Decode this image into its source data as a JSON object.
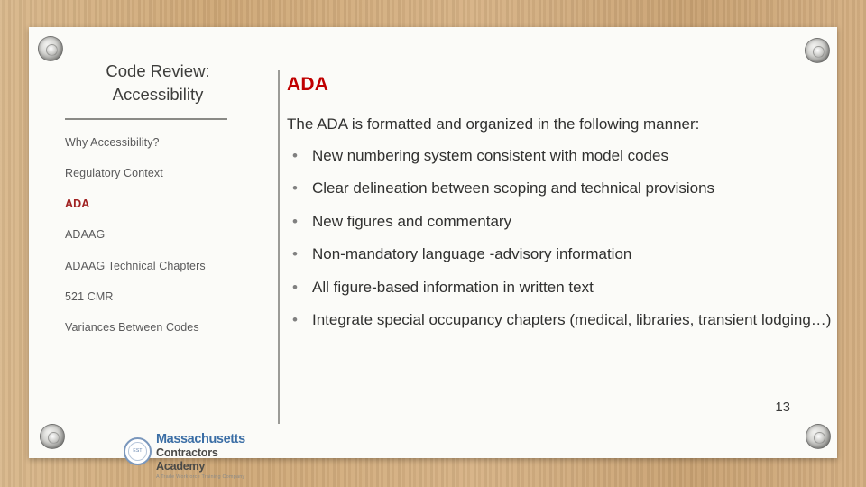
{
  "sidebar": {
    "title": "Code Review: Accessibility",
    "items": [
      {
        "label": "Why Accessibility?",
        "active": false
      },
      {
        "label": "Regulatory Context",
        "active": false
      },
      {
        "label": "ADA",
        "active": true
      },
      {
        "label": "ADAAG",
        "active": false
      },
      {
        "label": "ADAAG Technical Chapters",
        "active": false
      },
      {
        "label": "521 CMR",
        "active": false
      },
      {
        "label": "Variances Between Codes",
        "active": false
      }
    ]
  },
  "content": {
    "heading": "ADA",
    "intro": "The ADA is formatted and organized in the following manner:",
    "bullets": [
      "New numbering system consistent with model codes",
      "Clear delineation between scoping and technical provisions",
      "New figures and commentary",
      "Non-mandatory language -advisory information",
      "All figure-based information in written text",
      "Integrate special occupancy chapters (medical, libraries, transient lodging…)"
    ]
  },
  "footer": {
    "page_number": "13"
  },
  "logo": {
    "seal_text": "EST",
    "line1": "Massachusetts",
    "line2": "Contractors Academy",
    "line3": "A Trade Workforce Training Company"
  },
  "colors": {
    "accent_red": "#c00000",
    "active_nav": "#a02020",
    "board": "#fbfbf8",
    "frame": "#cfa877",
    "divider": "#9b9b97",
    "logo_blue": "#3b6ea5"
  }
}
